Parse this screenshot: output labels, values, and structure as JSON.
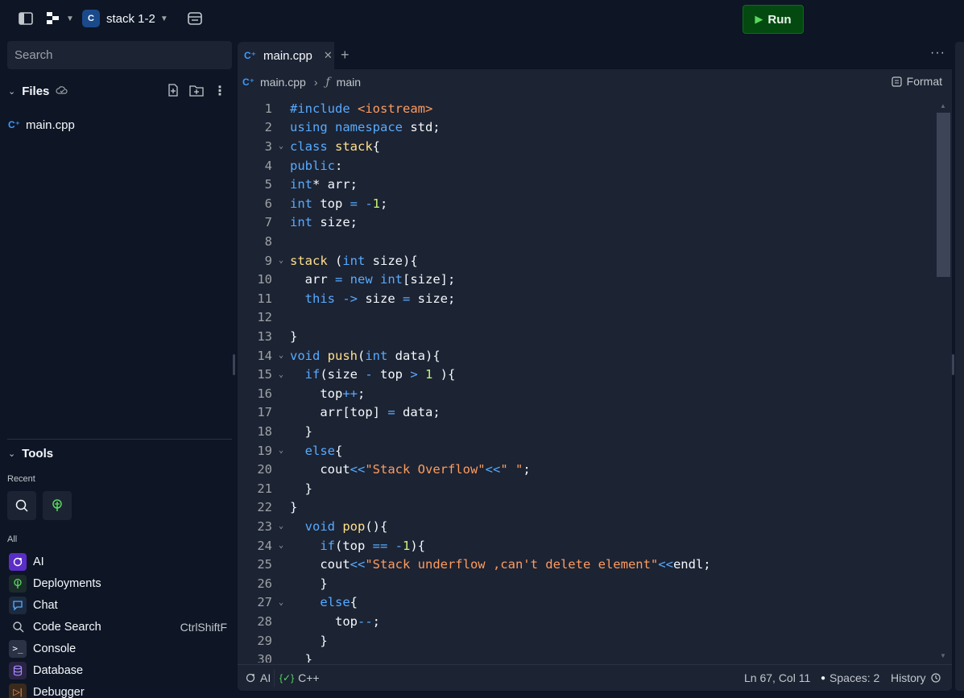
{
  "topbar": {
    "repl_name": "stack 1-2",
    "run_label": "Run",
    "colors": {
      "run_bg": "#044a10",
      "run_play": "#58d95e"
    }
  },
  "sidebar": {
    "search_placeholder": "Search",
    "files_label": "Files",
    "files": [
      {
        "name": "main.cpp"
      }
    ],
    "tools_label": "Tools",
    "recent_label": "Recent",
    "recent_icons": [
      "search-icon",
      "deployments-icon"
    ],
    "all_label": "All",
    "tools": [
      {
        "label": "AI",
        "icon": "ai-icon",
        "shortcut": ""
      },
      {
        "label": "Deployments",
        "icon": "deployments-icon",
        "shortcut": ""
      },
      {
        "label": "Chat",
        "icon": "chat-icon",
        "shortcut": ""
      },
      {
        "label": "Code Search",
        "icon": "search-icon",
        "shortcut": "CtrlShiftF"
      },
      {
        "label": "Console",
        "icon": "console-icon",
        "shortcut": ""
      },
      {
        "label": "Database",
        "icon": "database-icon",
        "shortcut": ""
      },
      {
        "label": "Debugger",
        "icon": "debugger-icon",
        "shortcut": ""
      }
    ]
  },
  "editor": {
    "tab_label": "main.cpp",
    "breadcrumb_file": "main.cpp",
    "breadcrumb_symbol": "main",
    "format_label": "Format",
    "code_lines": [
      {
        "n": "1",
        "fold": false
      },
      {
        "n": "2",
        "fold": false
      },
      {
        "n": "3",
        "fold": true
      },
      {
        "n": "4",
        "fold": false
      },
      {
        "n": "5",
        "fold": false
      },
      {
        "n": "6",
        "fold": false
      },
      {
        "n": "7",
        "fold": false
      },
      {
        "n": "8",
        "fold": false
      },
      {
        "n": "9",
        "fold": true
      },
      {
        "n": "10",
        "fold": false
      },
      {
        "n": "11",
        "fold": false
      },
      {
        "n": "12",
        "fold": false
      },
      {
        "n": "13",
        "fold": false
      },
      {
        "n": "14",
        "fold": true
      },
      {
        "n": "15",
        "fold": true
      },
      {
        "n": "16",
        "fold": false
      },
      {
        "n": "17",
        "fold": false
      },
      {
        "n": "18",
        "fold": false
      },
      {
        "n": "19",
        "fold": true
      },
      {
        "n": "20",
        "fold": false
      },
      {
        "n": "21",
        "fold": false
      },
      {
        "n": "22",
        "fold": false
      },
      {
        "n": "23",
        "fold": true
      },
      {
        "n": "24",
        "fold": true
      },
      {
        "n": "25",
        "fold": false
      },
      {
        "n": "26",
        "fold": false
      },
      {
        "n": "27",
        "fold": true
      },
      {
        "n": "28",
        "fold": false
      },
      {
        "n": "29",
        "fold": false
      },
      {
        "n": "30",
        "fold": false
      }
    ],
    "code_tokens": [
      [
        [
          "kw",
          "#include "
        ],
        [
          "str",
          "<iostream>"
        ]
      ],
      [
        [
          "kw",
          "using namespace "
        ],
        [
          "src",
          "std;"
        ]
      ],
      [
        [
          "kw",
          "class "
        ],
        [
          "fnc",
          "stack"
        ],
        [
          "src",
          "{"
        ]
      ],
      [
        [
          "kw",
          "public"
        ],
        [
          "src",
          ":"
        ]
      ],
      [
        [
          "kw",
          "int"
        ],
        [
          "src",
          "* arr;"
        ]
      ],
      [
        [
          "kw",
          "int "
        ],
        [
          "src",
          "top "
        ],
        [
          "op",
          "= -"
        ],
        [
          "num",
          "1"
        ],
        [
          "src",
          ";"
        ]
      ],
      [
        [
          "kw",
          "int "
        ],
        [
          "src",
          "size;"
        ]
      ],
      [],
      [
        [
          "fnc",
          "stack "
        ],
        [
          "src",
          "("
        ],
        [
          "kw",
          "int "
        ],
        [
          "src",
          "size){"
        ]
      ],
      [
        [
          "src",
          "  arr "
        ],
        [
          "op",
          "= "
        ],
        [
          "kw",
          "new int"
        ],
        [
          "src",
          "[size];"
        ]
      ],
      [
        [
          "kw",
          "  this "
        ],
        [
          "op",
          "-> "
        ],
        [
          "src",
          "size "
        ],
        [
          "op",
          "= "
        ],
        [
          "src",
          "size;"
        ]
      ],
      [],
      [
        [
          "src",
          "}"
        ]
      ],
      [
        [
          "kw",
          "void "
        ],
        [
          "fnc",
          "push"
        ],
        [
          "src",
          "("
        ],
        [
          "kw",
          "int "
        ],
        [
          "src",
          "data){"
        ]
      ],
      [
        [
          "kw",
          "  if"
        ],
        [
          "src",
          "(size "
        ],
        [
          "op",
          "- "
        ],
        [
          "src",
          "top "
        ],
        [
          "op",
          "> "
        ],
        [
          "num",
          "1 "
        ],
        [
          "src",
          "){"
        ]
      ],
      [
        [
          "src",
          "    top"
        ],
        [
          "op",
          "++"
        ],
        [
          "src",
          ";"
        ]
      ],
      [
        [
          "src",
          "    arr[top] "
        ],
        [
          "op",
          "= "
        ],
        [
          "src",
          "data;"
        ]
      ],
      [
        [
          "src",
          "  }"
        ]
      ],
      [
        [
          "kw",
          "  else"
        ],
        [
          "src",
          "{"
        ]
      ],
      [
        [
          "src",
          "    cout"
        ],
        [
          "op",
          "<<"
        ],
        [
          "str",
          "\"Stack Overflow\""
        ],
        [
          "op",
          "<<"
        ],
        [
          "str",
          "\" \""
        ],
        [
          "src",
          ";"
        ]
      ],
      [
        [
          "src",
          "  }"
        ]
      ],
      [
        [
          "src",
          "}"
        ]
      ],
      [
        [
          "kw",
          "  void "
        ],
        [
          "fnc",
          "pop"
        ],
        [
          "src",
          "(){"
        ]
      ],
      [
        [
          "kw",
          "    if"
        ],
        [
          "src",
          "(top "
        ],
        [
          "op",
          "== -"
        ],
        [
          "num",
          "1"
        ],
        [
          "src",
          "){"
        ]
      ],
      [
        [
          "src",
          "    cout"
        ],
        [
          "op",
          "<<"
        ],
        [
          "str",
          "\"Stack underflow ,can't delete element\""
        ],
        [
          "op",
          "<<"
        ],
        [
          "src",
          "endl;"
        ]
      ],
      [
        [
          "src",
          "    }"
        ]
      ],
      [
        [
          "kw",
          "    else"
        ],
        [
          "src",
          "{"
        ]
      ],
      [
        [
          "src",
          "      top"
        ],
        [
          "op",
          "--"
        ],
        [
          "src",
          ";"
        ]
      ],
      [
        [
          "src",
          "    }"
        ]
      ],
      [
        [
          "src",
          "  }"
        ]
      ]
    ]
  },
  "status": {
    "ai_label": "AI",
    "lang_label": "C++",
    "cursor": "Ln 67, Col 11",
    "spaces": "Spaces: 2",
    "history": "History"
  }
}
